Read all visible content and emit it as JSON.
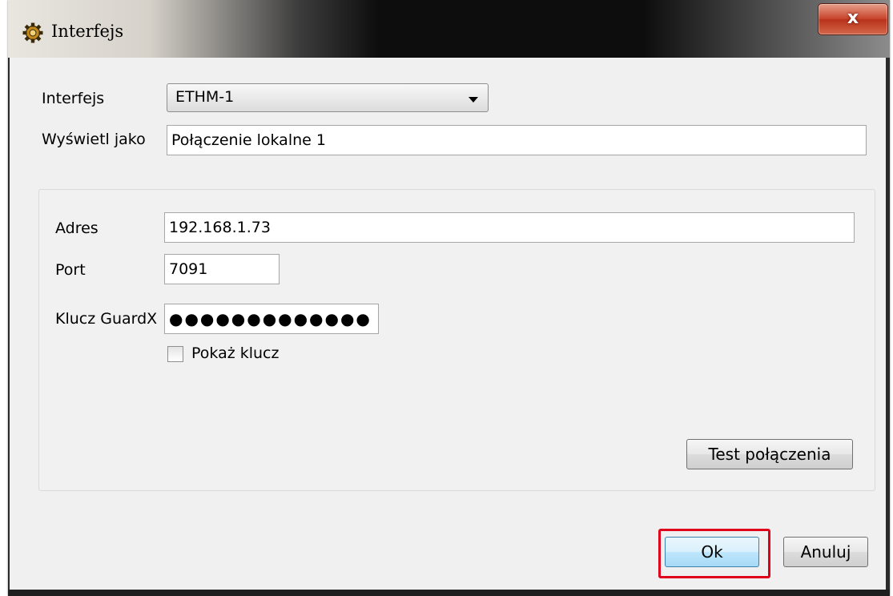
{
  "window": {
    "title": "Interfejs",
    "close_label": "x",
    "icon": "gear-icon"
  },
  "form": {
    "interface_label": "Interfejs",
    "interface_value": "ETHM-1",
    "display_as_label": "Wyświetl jako",
    "display_as_value": "Połączenie lokalne 1"
  },
  "connection": {
    "address_label": "Adres",
    "address_value": "192.168.1.73",
    "port_label": "Port",
    "port_value": "7091",
    "key_label": "Klucz GuardX",
    "key_masked": "●●●●●●●●●●●●●",
    "show_key_label": "Pokaż klucz",
    "show_key_checked": false,
    "test_button": "Test połączenia"
  },
  "buttons": {
    "ok": "Ok",
    "cancel": "Anuluj"
  },
  "colors": {
    "highlight": "#e0001b",
    "close_button": "#c9452d"
  }
}
